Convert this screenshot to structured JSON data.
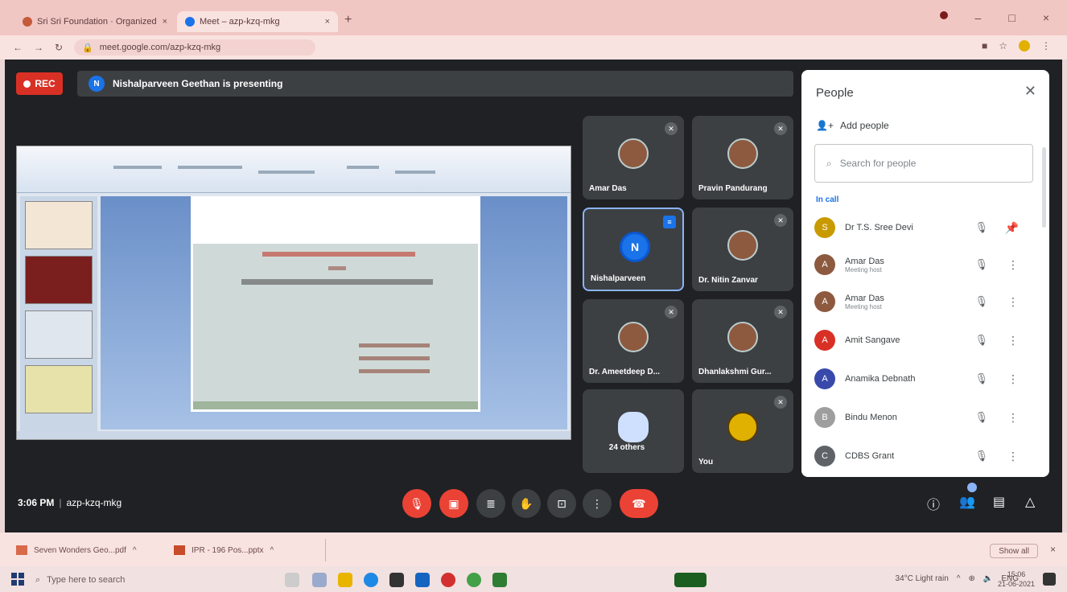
{
  "browser": {
    "tabs": [
      {
        "label": "Sri Sri Foundation · Organized",
        "active": false
      },
      {
        "label": "Meet – azp-kzq-mkg",
        "active": true
      }
    ],
    "url": "meet.google.com/azp-kzq-mkg"
  },
  "meeting": {
    "rec_label": "REC",
    "presenting_initial": "N",
    "presenting_text": "Nishalparveen Geethan is presenting",
    "time": "3:06 PM",
    "meeting_code": "azp-kzq-mkg"
  },
  "tiles": [
    {
      "name": "Amar Das"
    },
    {
      "name": "Pravin Pandurang"
    },
    {
      "name": "Nishalparveen",
      "initial": "N"
    },
    {
      "name": "Dr. Nitin Zanvar"
    },
    {
      "name": "Dr. Ameetdeep D..."
    },
    {
      "name": "Dhanlakshmi Gur..."
    },
    {
      "name": "24 others"
    },
    {
      "name": "You"
    }
  ],
  "people": {
    "title": "People",
    "add_people": "Add people",
    "search_placeholder": "Search for people",
    "section": "In call",
    "rows": [
      {
        "name": "Dr T.S. Sree Devi",
        "initial": "S",
        "color": "#c99a00"
      },
      {
        "name": "Amar Das",
        "sub": "Meeting host",
        "initial": "A",
        "color": "#8d5a40"
      },
      {
        "name": "Amar Das",
        "sub": "Meeting host",
        "initial": "A",
        "color": "#8d5a40"
      },
      {
        "name": "Amit Sangave",
        "initial": "A",
        "color": "#d93025"
      },
      {
        "name": "Anamika Debnath",
        "initial": "A",
        "color": "#3949ab"
      },
      {
        "name": "Bindu Menon",
        "initial": "B",
        "color": "#9e9e9e"
      },
      {
        "name": "CDBS Grant",
        "initial": "C",
        "color": "#5f6368"
      }
    ]
  },
  "downloads": [
    {
      "label": "Seven Wonders Geo...pdf"
    },
    {
      "label": "IPR - 196 Pos...pptx"
    }
  ],
  "downloads_show_all": "Show all",
  "taskbar": {
    "search_placeholder": "Type here to search",
    "weather": "34°C Light rain",
    "time": "15:06",
    "date": "21-06-2021",
    "lang": "ENG"
  }
}
